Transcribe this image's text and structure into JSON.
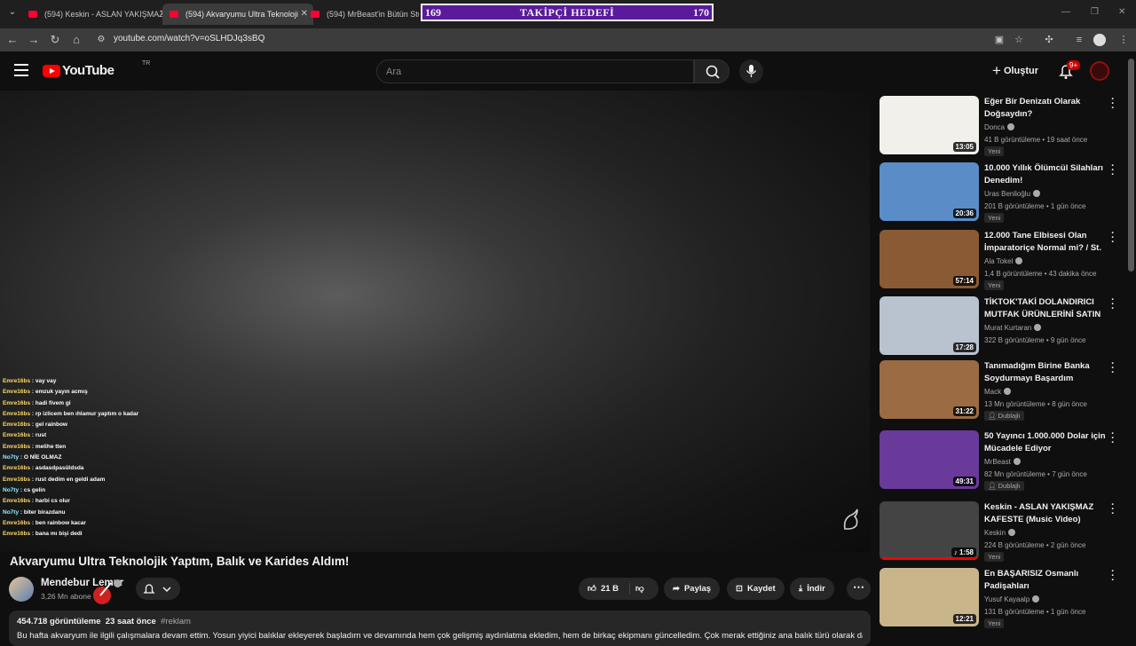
{
  "browser": {
    "tabs": [
      {
        "label": "(594) Keskin - ASLAN YAKIŞMAZ",
        "active": false
      },
      {
        "label": "(594) Akvaryumu Ultra Teknoloji",
        "active": true
      },
      {
        "label": "(594) MrBeast'in Bütün Stüdyo",
        "active": false
      }
    ],
    "url": "youtube.com/watch?v=oSLHDJq3sBQ"
  },
  "overlay": {
    "left": "169",
    "center": "TAKİPÇİ HEDEFİ",
    "right": "170",
    "color": "#5b1a9b"
  },
  "masthead": {
    "logo_text": "YouTube",
    "country_code": "TR",
    "search_placeholder": "Ara",
    "create_label": "Oluştur",
    "notifications_badge": "9+"
  },
  "chat": [
    {
      "user": "Emre16bs",
      "msg": "vay vay",
      "color": "u1"
    },
    {
      "user": "Emre16bs",
      "msg": "emzuk yayın acmış",
      "color": "u1"
    },
    {
      "user": "Emre16bs",
      "msg": "hadi fivem gi",
      "color": "u1"
    },
    {
      "user": "Emre16bs",
      "msg": "rp izlicem ben ıhlamur yaptım o kadar",
      "color": "u1"
    },
    {
      "user": "Emre16bs",
      "msg": "gel rainbow",
      "color": "u1"
    },
    {
      "user": "Emre16bs",
      "msg": "rust",
      "color": "u1"
    },
    {
      "user": "Emre16bs",
      "msg": "melihe tten",
      "color": "u1"
    },
    {
      "user": "No7ty",
      "msg": "O NİE OLMAZ",
      "color": "u2"
    },
    {
      "user": "Emre16bs",
      "msg": "asdasdpasüldsda",
      "color": "u1"
    },
    {
      "user": "Emre16bs",
      "msg": "rust dedim en geldi adam",
      "color": "u1"
    },
    {
      "user": "No7ty",
      "msg": "cs gelin",
      "color": "u2"
    },
    {
      "user": "Emre16bs",
      "msg": "harbi cs olur",
      "color": "u1"
    },
    {
      "user": "No7ty",
      "msg": "biter birazdanu",
      "color": "u2"
    },
    {
      "user": "Emre16bs",
      "msg": "ben rainbow kacar",
      "color": "u1"
    },
    {
      "user": "Emre16bs",
      "msg": "bana mı bişi dedi",
      "color": "u1"
    }
  ],
  "video": {
    "title": "Akvaryumu Ultra Teknolojik Yaptım, Balık ve Karides Aldım!",
    "channel": "Mendebur Lemur",
    "subscribers": "3,26 Mn abone",
    "likes": "21 B",
    "share_label": "Paylaş",
    "save_label": "Kaydet",
    "download_label": "İndir",
    "views": "454.718 görüntüleme",
    "age": "23 saat önce",
    "hashtag": "#reklam",
    "description": "Bu hafta akvaryum ile ilgili çalışmalara devam ettim. Yosun yiyici balıklar ekleyerek başladım ve devamında hem çok gelişmiş aydınlatma ekledim, hem de birkaç ekipmanı güncelledim. Çok merak ettiğiniz ana balık türü olarak da"
  },
  "recommendations": [
    {
      "title": "Eğer Bir Denizatı Olarak Doğsaydın?",
      "channel": "Donca",
      "views": "41 B görüntüleme",
      "age": "19 saat önce",
      "duration": "13:05",
      "badge": "Yeni",
      "thumb_bg": "#f2f0ea"
    },
    {
      "title": "10.000 Yıllık Ölümcül Silahları Denedim!",
      "channel": "Uras Benlioğlu",
      "views": "201 B görüntüleme",
      "age": "1 gün önce",
      "duration": "20:36",
      "badge": "Yeni",
      "thumb_bg": "#5a8cc8"
    },
    {
      "title": "12.000 Tane Elbisesi Olan İmparatoriçe Normal mi? / St. ...",
      "channel": "Ala Tokel",
      "views": "1,4 B görüntüleme",
      "age": "43 dakika önce",
      "duration": "57:14",
      "badge": "Yeni",
      "thumb_bg": "#8a5a34"
    },
    {
      "title": "TİKTOK'TAKİ DOLANDIRICI MUTFAK ÜRÜNLERİNİ SATIN ...",
      "channel": "Murat Kurtaran",
      "views": "322 B görüntüleme",
      "age": "9 gün önce",
      "duration": "17:28",
      "badge": "",
      "thumb_bg": "#b9c3cf"
    },
    {
      "title": "Tanımadığım Birine Banka Soydurmayı Başardım",
      "channel": "Mack",
      "views": "13 Mn görüntüleme",
      "age": "8 gün önce",
      "duration": "31:22",
      "badge": "Dublajlı",
      "thumb_bg": "#9b6b43"
    },
    {
      "title": "50 Yayıncı 1.000.000 Dolar için Mücadele Ediyor",
      "channel": "MrBeast",
      "views": "82 Mn görüntüleme",
      "age": "7 gün önce",
      "duration": "49:31",
      "badge": "Dublajlı",
      "thumb_bg": "#6a3a9a"
    },
    {
      "title": "Keskin - ASLAN YAKIŞMAZ KAFESTE (Music Video)",
      "channel": "Keskin",
      "views": "224 B görüntüleme",
      "age": "2 gün önce",
      "duration": "1:58",
      "badge": "Yeni",
      "thumb_bg": "#444444",
      "music": true
    },
    {
      "title": "En BAŞARISIZ Osmanlı Padişahları",
      "channel": "Yusuf Kayaalp",
      "views": "131 B görüntüleme",
      "age": "1 gün önce",
      "duration": "12:21",
      "badge": "Yeni",
      "thumb_bg": "#c9b58a"
    }
  ]
}
